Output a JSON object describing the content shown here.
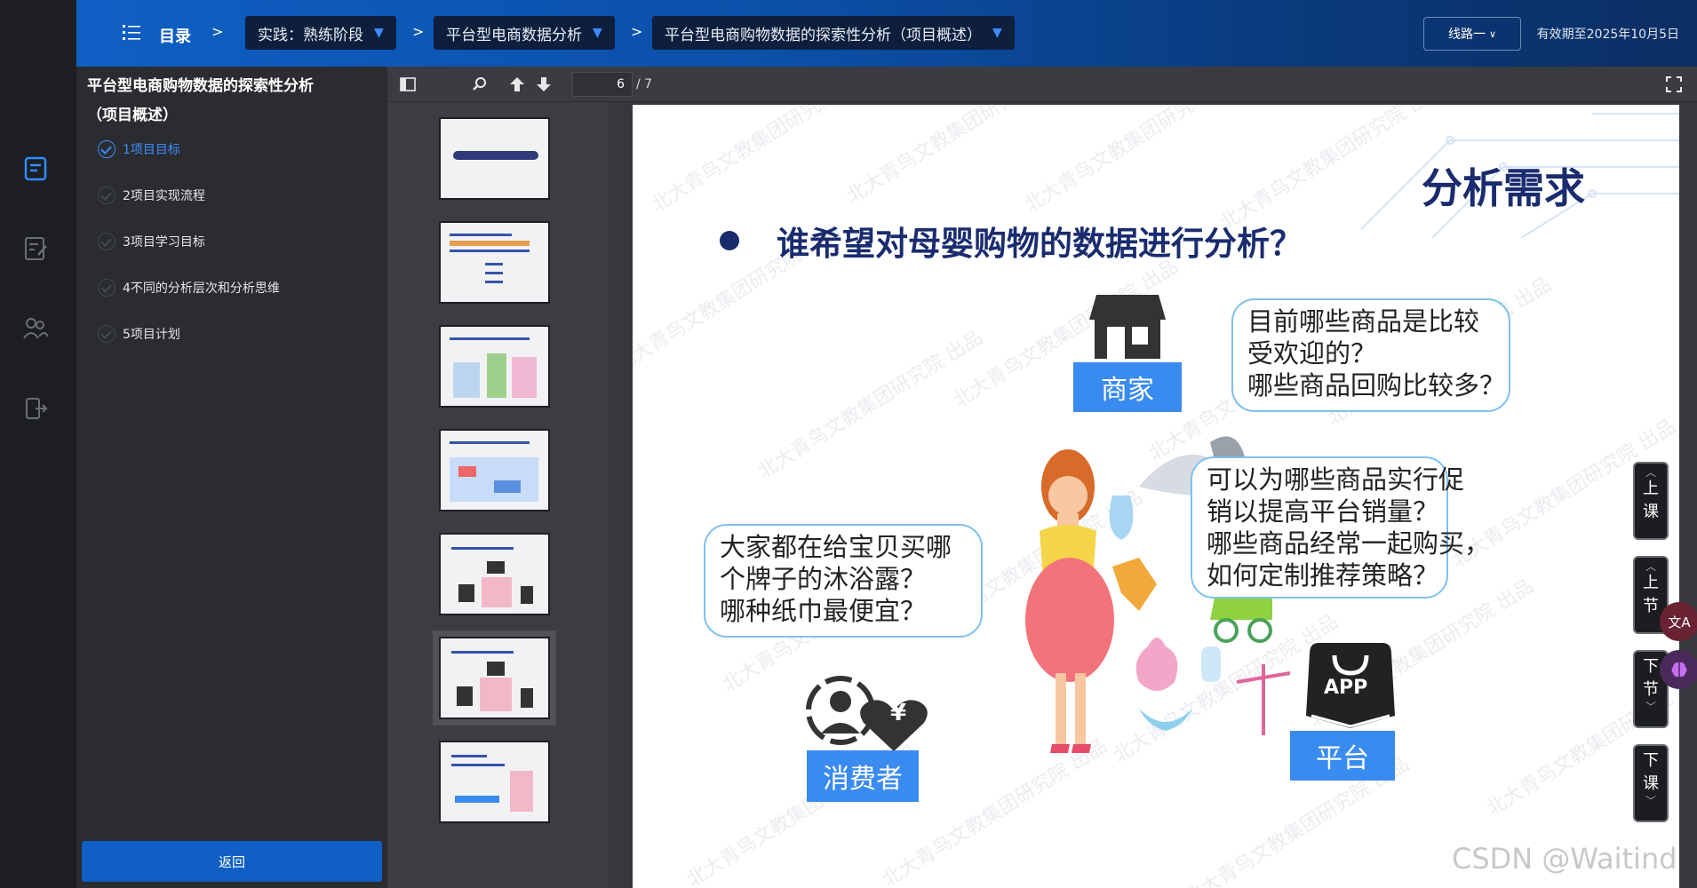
{
  "header": {
    "menu_label": "目录",
    "crumbs": [
      "实践：熟练阶段",
      "平台型电商数据分析",
      "平台型电商购物数据的探索性分析（项目概述）"
    ],
    "crumb_separator": ">",
    "route_button": "线路一",
    "expiry": "有效期至2025年10月5日"
  },
  "outline": {
    "title": "平台型电商购物数据的探索性分析（项目概述）",
    "items": [
      {
        "label": "1项目目标",
        "active": true
      },
      {
        "label": "2项目实现流程",
        "active": false
      },
      {
        "label": "3项目学习目标",
        "active": false
      },
      {
        "label": "4不同的分析层次和分析思维",
        "active": false
      },
      {
        "label": "5项目计划",
        "active": false
      }
    ],
    "back_button": "返回"
  },
  "viewer": {
    "current_page": "6",
    "total_pages": "/ 7",
    "selected_thumb": 6
  },
  "slide": {
    "heading": "分析需求",
    "question": "谁希望对母婴购物的数据进行分析？",
    "merchant": {
      "label": "商家",
      "lines": [
        "目前哪些商品是比较",
        "受欢迎的？",
        "哪些商品回购比较多？"
      ]
    },
    "consumer": {
      "label": "消费者",
      "lines": [
        "大家都在给宝贝买哪",
        "个牌子的沐浴露？",
        "哪种纸巾最便宜？"
      ]
    },
    "platform": {
      "label": "平台",
      "app_text": "APP",
      "lines": [
        "可以为哪些商品实行促",
        "销以提高平台销量？",
        "哪些商品经常一起购买，",
        "如何定制推荐策略？"
      ]
    },
    "currency_symbol": "¥",
    "watermark": "北大青鸟文教集团研究院 出品"
  },
  "side_nav": [
    {
      "label": [
        "上",
        "课"
      ]
    },
    {
      "label": [
        "上",
        "节"
      ]
    },
    {
      "label": [
        "下",
        "节"
      ]
    },
    {
      "label": [
        "下",
        "课"
      ]
    }
  ],
  "floating": {
    "translate": "文A"
  },
  "credit": "CSDN @Waitind",
  "colors": {
    "accent": "#0f5fc4",
    "active": "#3d8cff",
    "slide_navy": "#1a2c6e",
    "label_blue": "#3a8bf0"
  }
}
